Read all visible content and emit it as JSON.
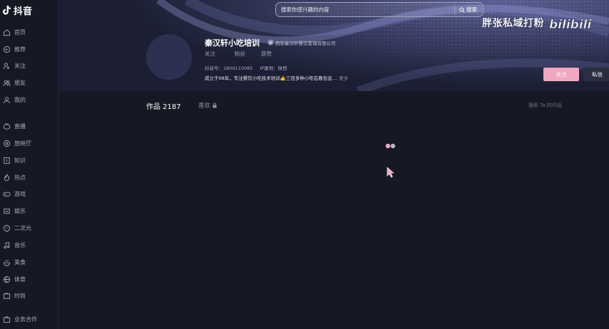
{
  "app": {
    "name": "抖音"
  },
  "sidebar": {
    "items": [
      {
        "label": "首页",
        "icon": "home-icon"
      },
      {
        "label": "推荐",
        "icon": "recommend-icon"
      },
      {
        "label": "关注",
        "icon": "follow-icon"
      },
      {
        "label": "朋友",
        "icon": "friends-icon"
      },
      {
        "label": "我的",
        "icon": "me-icon"
      },
      {
        "label": "直播",
        "icon": "live-icon"
      },
      {
        "label": "放映厅",
        "icon": "cinema-icon"
      },
      {
        "label": "知识",
        "icon": "knowledge-icon"
      },
      {
        "label": "热点",
        "icon": "hot-icon"
      },
      {
        "label": "游戏",
        "icon": "game-icon"
      },
      {
        "label": "娱乐",
        "icon": "entertainment-icon"
      },
      {
        "label": "二次元",
        "icon": "anime-icon"
      },
      {
        "label": "音乐",
        "icon": "music-icon"
      },
      {
        "label": "美食",
        "icon": "food-icon"
      },
      {
        "label": "体育",
        "icon": "sports-icon"
      },
      {
        "label": "时尚",
        "icon": "fashion-icon"
      },
      {
        "label": "业务合作",
        "icon": "business-icon"
      }
    ]
  },
  "search": {
    "placeholder": "搜索你感兴趣的内容",
    "button_label": "搜索"
  },
  "watermark": {
    "text": "胖张私域打粉",
    "logo": "bilibili"
  },
  "profile": {
    "name": "秦汉轩小吃培训",
    "verification": "西安秦汉轩餐饮管理有限公司",
    "stats": {
      "following_label": "关注",
      "followers_label": "粉丝",
      "likes_label": "获赞"
    },
    "id_label": "抖音号：1809110085",
    "ip_label": "IP属地：陕西",
    "bio": "成立于08年，专注餐饮小吃技术培训👍三百多种小吃在教包会…",
    "bio_more": "更多",
    "follow_button": "关注",
    "message_button": "私信"
  },
  "tabs": {
    "works": "作品 2187",
    "likes": "喜欢",
    "search_works": "搜索 Ta 的作品"
  },
  "colors": {
    "background": "#161823",
    "accent": "#f2a7c0",
    "banner": "#3b3f67"
  }
}
